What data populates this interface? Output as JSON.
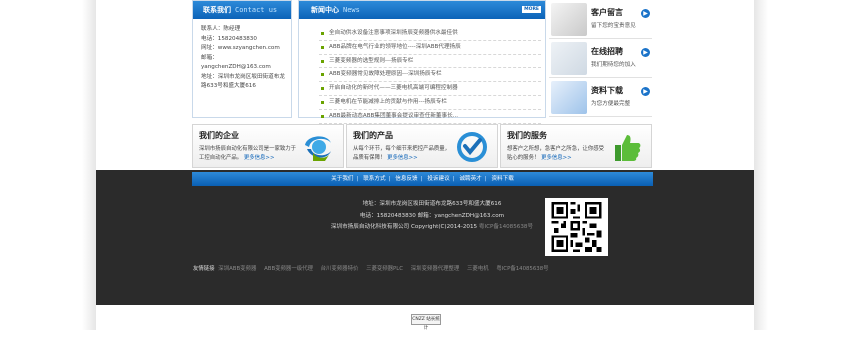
{
  "contact": {
    "title": "联系我们",
    "title_en": "Contact us",
    "lines": [
      "联系人：陈经理",
      "电话：15820483830",
      "网址：www.szyangchen.com",
      "邮箱：yangchenZDH@163.com",
      "地址：深圳市龙岗区坂田街道布龙",
      "路633号和盛大厦616"
    ]
  },
  "news": {
    "title": "新闻中心",
    "title_en": "News",
    "more": "MORE",
    "items": [
      "全自动供水设备注意事项深圳扬辰变频器供水最佳供",
      "ABB品牌在电气行业的领导地位----深圳ABB代理扬辰",
      "三菱变频器的选型规则---扬辰专栏",
      "ABB变频器常见故障处理原因---深圳扬辰专栏",
      "开启自动化的新时代——三菱电机高端可编程控制器",
      "三菱电机在节能减排上的贡献与作用---扬辰专栏",
      "ABB最新动态ABB集团董事会提议审查任新董事长..."
    ]
  },
  "side": [
    {
      "title": "客户留言",
      "desc": "留下您的宝贵意见"
    },
    {
      "title": "在线招聘",
      "desc": "我们期待您的加入"
    },
    {
      "title": "资料下载",
      "desc": "为您方便最完整"
    }
  ],
  "cards": [
    {
      "title": "我们的企业",
      "desc": "深圳市扬辰自动化有限公司是一家致力于工控自动化产品。",
      "more": "更多信息>>"
    },
    {
      "title": "我们的产品",
      "desc": "从每个环节，每个细节来把控产品质量，品质有保障！",
      "more": "更多信息>>"
    },
    {
      "title": "我们的服务",
      "desc": "想客户之所想，急客户之所急，让你感受贴心的服务！",
      "more": "更多信息>>"
    }
  ],
  "footer_nav": [
    "关于我们",
    "联系方式",
    "信息反馈",
    "投诉建议",
    "诚聘英才",
    "资料下载"
  ],
  "footer": {
    "address": "地址：深圳市龙岗区坂田街道布龙路633号和盛大厦616",
    "contact": "电话：15820483830 邮箱：yangchenZDH@163.com",
    "copyright": "深圳市扬辰自动化科技有限公司 Copyright(C)2014-2015",
    "icp": "粤ICP备14085638号"
  },
  "friend_links": {
    "label": "友情链接",
    "items": [
      "深圳ABB变频器",
      "ABB变频器一级代理",
      "台川变频器特价",
      "三菱变频器PLC",
      "深圳变频器代理整理",
      "三菱电机",
      "粤ICP备14085638号"
    ]
  },
  "badge": "CNZZ 站长统计"
}
